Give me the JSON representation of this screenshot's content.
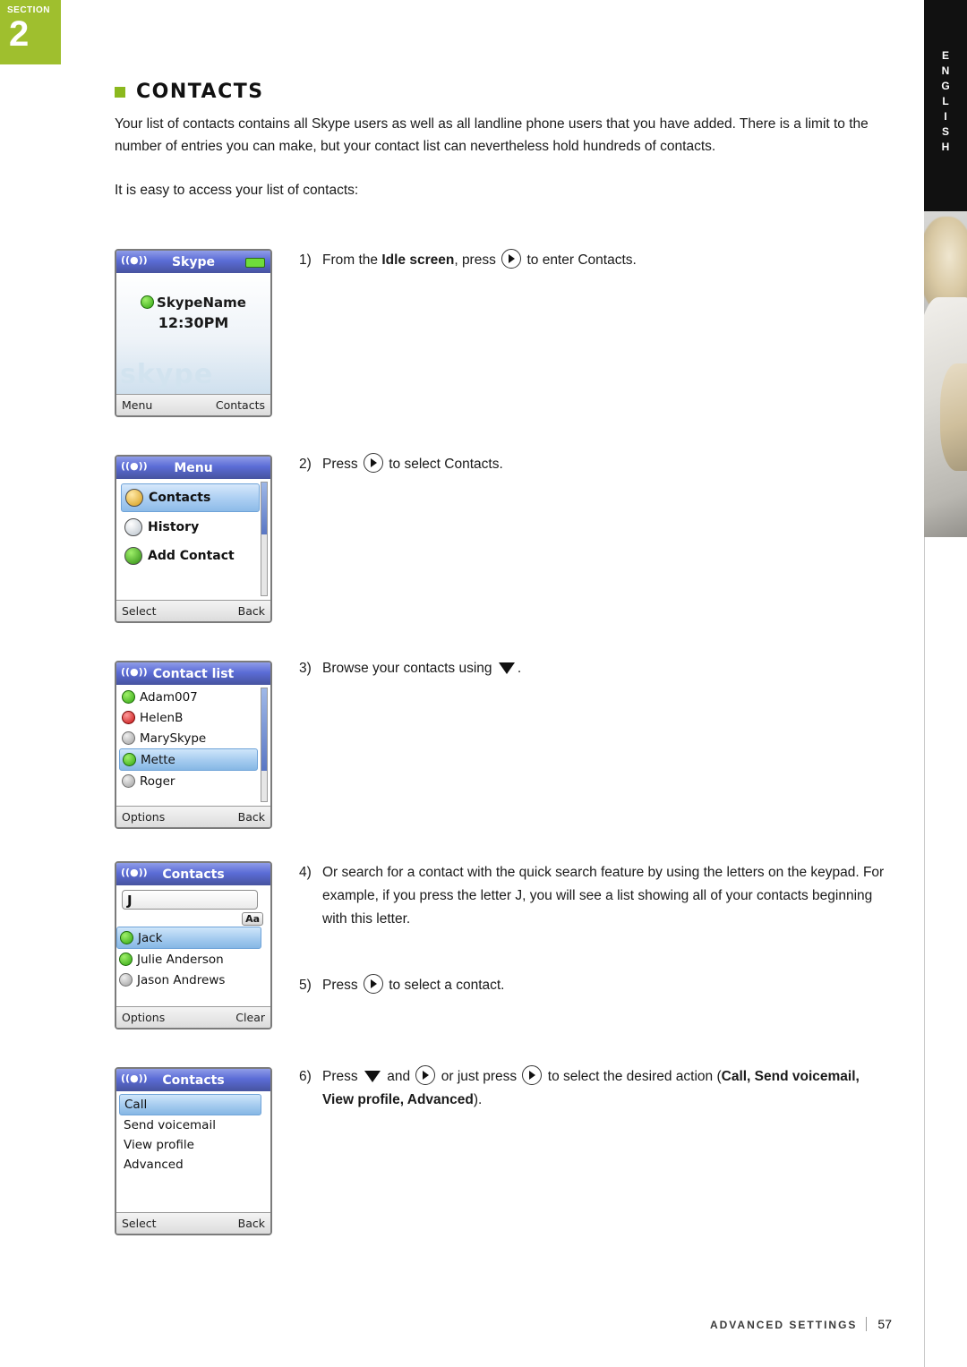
{
  "section": {
    "word": "SECTION",
    "number": "2"
  },
  "rail": {
    "language": "ENGLISH"
  },
  "heading": "CONTACTS",
  "intro_paragraph": "Your list of contacts contains all Skype users as well as all landline phone users that you have added. There is a limit to the number of entries you can make, but your contact list can nevertheless hold hundreds of contacts.",
  "access_paragraph": "It is easy to access your list of contacts:",
  "steps": [
    {
      "num": "1)",
      "pre": "From the ",
      "bold1": "Idle screen",
      "mid": ", press ",
      "post": " to enter Contacts."
    },
    {
      "num": "2)",
      "pre": "Press ",
      "post": " to select Contacts."
    },
    {
      "num": "3)",
      "pre": "Browse your contacts using ",
      "post": "."
    },
    {
      "num": "4)",
      "text": "Or search for a contact with the quick search feature by using the letters on the keypad. For example, if you press the letter J, you will see a list showing all of your contacts beginning with this letter."
    },
    {
      "num": "5)",
      "pre": "Press ",
      "post": " to select a contact."
    },
    {
      "num": "6)",
      "pre": "Press ",
      "mid1": " and ",
      "mid2": " or just press ",
      "mid3": " to select the desired action (",
      "bold": "Call, Send voicemail, View profile, Advanced",
      "post": ")."
    }
  ],
  "screens": {
    "idle": {
      "title": "Skype",
      "name": "SkypeName",
      "time": "12:30PM",
      "watermark": "skype",
      "softkey_left": "Menu",
      "softkey_right": "Contacts"
    },
    "menu": {
      "title": "Menu",
      "items": [
        {
          "label": "Contacts",
          "selected": true
        },
        {
          "label": "History",
          "selected": false
        },
        {
          "label": "Add Contact",
          "selected": false
        }
      ],
      "softkey_left": "Select",
      "softkey_right": "Back"
    },
    "contact_list": {
      "title": "Contact list",
      "items": [
        {
          "label": "Adam007",
          "status": "online",
          "selected": false
        },
        {
          "label": "HelenB",
          "status": "busy",
          "selected": false
        },
        {
          "label": "MarySkype",
          "status": "offline",
          "selected": false
        },
        {
          "label": "Mette",
          "status": "online",
          "selected": true
        },
        {
          "label": "Roger",
          "status": "offline",
          "selected": false
        }
      ],
      "softkey_left": "Options",
      "softkey_right": "Back"
    },
    "search": {
      "title": "Contacts",
      "query": "J",
      "input_mode": "Aa",
      "items": [
        {
          "label": "Jack",
          "status": "online",
          "selected": true
        },
        {
          "label": "Julie Anderson",
          "status": "online",
          "selected": false
        },
        {
          "label": "Jason Andrews",
          "status": "offline",
          "selected": false
        }
      ],
      "softkey_left": "Options",
      "softkey_right": "Clear"
    },
    "actions": {
      "title": "Contacts",
      "items": [
        {
          "label": "Call",
          "selected": true
        },
        {
          "label": "Send voicemail",
          "selected": false
        },
        {
          "label": "View profile",
          "selected": false
        },
        {
          "label": "Advanced",
          "selected": false
        }
      ],
      "softkey_left": "Select",
      "softkey_right": "Back"
    }
  },
  "footer": {
    "label": "ADVANCED SETTINGS",
    "page": "57"
  }
}
